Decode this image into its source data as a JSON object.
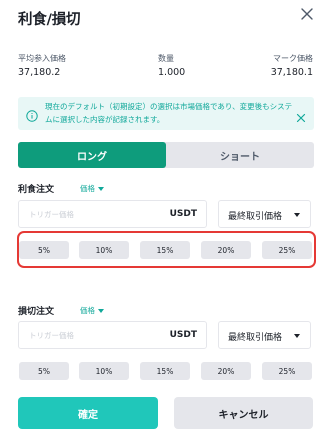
{
  "header": {
    "title": "利食/損切"
  },
  "stats": {
    "avg_entry_label": "平均参入価格",
    "avg_entry_value": "37,180.2",
    "quantity_label": "数量",
    "quantity_value": "1.000",
    "mark_price_label": "マーク価格",
    "mark_price_value": "37,180.1"
  },
  "notice": {
    "text": "現在のデフォルト（初期設定）の選択は市場価格であり、変更後もシステムに選択した内容が記録されます。"
  },
  "tabs": {
    "long": "ロング",
    "short": "ショート",
    "active": "long"
  },
  "take_profit": {
    "label": "利食注文",
    "price_type": "価格",
    "trigger_placeholder": "トリガー価格",
    "unit": "USDT",
    "select_value": "最終取引価格",
    "percentages": [
      "5%",
      "10%",
      "15%",
      "20%",
      "25%"
    ]
  },
  "stop_loss": {
    "label": "損切注文",
    "price_type": "価格",
    "trigger_placeholder": "トリガー価格",
    "unit": "USDT",
    "select_value": "最終取引価格",
    "percentages": [
      "5%",
      "10%",
      "15%",
      "20%",
      "25%"
    ]
  },
  "footer": {
    "confirm": "確定",
    "cancel": "キャンセル"
  },
  "colors": {
    "accent": "#0e9c7c",
    "confirm": "#20c7ba",
    "notice_bg": "#e8f7f6",
    "notice_text": "#10a89a",
    "highlight": "#e53935"
  }
}
